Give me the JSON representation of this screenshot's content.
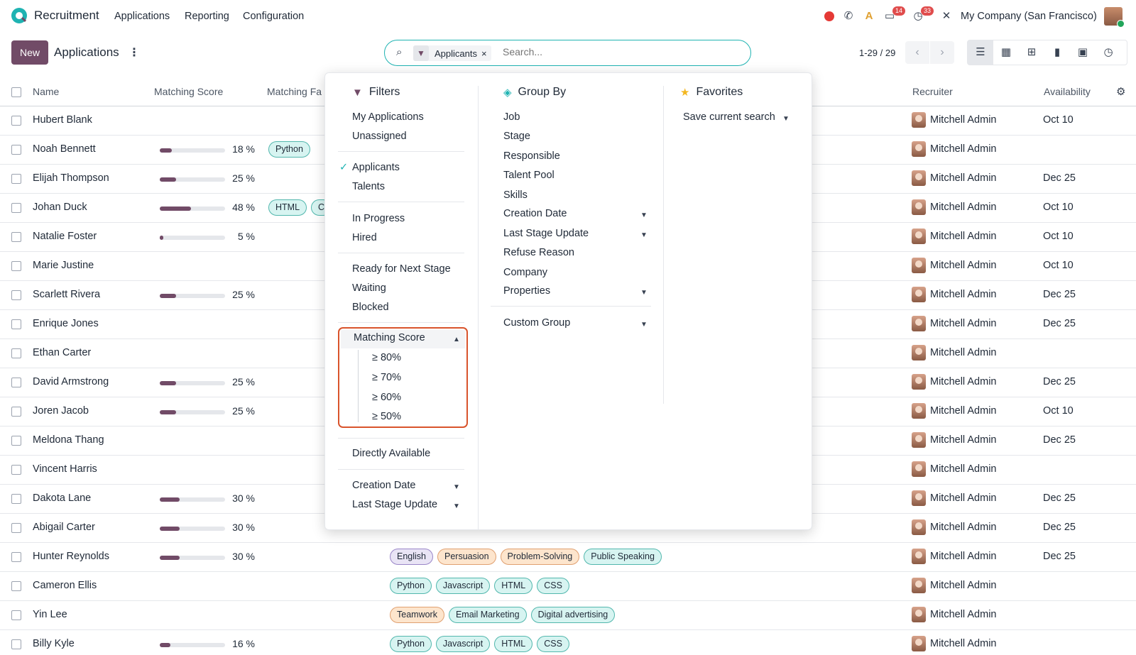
{
  "navbar": {
    "app_title": "Recruitment",
    "menu": [
      "Applications",
      "Reporting",
      "Configuration"
    ],
    "badges": {
      "messages": "14",
      "activities": "33"
    },
    "company": "My Company (San Francisco)"
  },
  "control": {
    "new_label": "New",
    "title": "Applications",
    "kebab": "⋮",
    "facet_label": "Applicants",
    "facet_remove": "×",
    "search_placeholder": "Search...",
    "pager": "1-29 / 29"
  },
  "columns": {
    "name": "Name",
    "matching_score": "Matching Score",
    "matching_factors": "Matching Fa",
    "recruiter": "Recruiter",
    "availability": "Availability"
  },
  "rows": [
    {
      "name": "Hubert Blank",
      "score": null,
      "score_label": "",
      "tags": [],
      "recruiter": "Mitchell Admin",
      "availability": "Oct 10"
    },
    {
      "name": "Noah Bennett",
      "score": 18,
      "score_label": "18 %",
      "tags": [
        {
          "label": "Python",
          "color": "teal"
        }
      ],
      "recruiter": "Mitchell Admin",
      "availability": ""
    },
    {
      "name": "Elijah Thompson",
      "score": 25,
      "score_label": "25 %",
      "tags": [],
      "recruiter": "Mitchell Admin",
      "availability": "Dec 25"
    },
    {
      "name": "Johan Duck",
      "score": 48,
      "score_label": "48 %",
      "tags": [
        {
          "label": "HTML",
          "color": "teal"
        },
        {
          "label": "C",
          "color": "teal"
        }
      ],
      "recruiter": "Mitchell Admin",
      "availability": "Oct 10"
    },
    {
      "name": "Natalie Foster",
      "score": 5,
      "score_label": "5 %",
      "tags": [],
      "recruiter": "Mitchell Admin",
      "availability": "Oct 10"
    },
    {
      "name": "Marie Justine",
      "score": null,
      "score_label": "",
      "tags": [],
      "recruiter": "Mitchell Admin",
      "availability": "Oct 10"
    },
    {
      "name": "Scarlett Rivera",
      "score": 25,
      "score_label": "25 %",
      "tags": [],
      "recruiter": "Mitchell Admin",
      "availability": "Dec 25"
    },
    {
      "name": "Enrique Jones",
      "score": null,
      "score_label": "",
      "tags": [],
      "recruiter": "Mitchell Admin",
      "availability": "Dec 25"
    },
    {
      "name": "Ethan Carter",
      "score": null,
      "score_label": "",
      "tags": [],
      "recruiter": "Mitchell Admin",
      "availability": ""
    },
    {
      "name": "David Armstrong",
      "score": 25,
      "score_label": "25 %",
      "tags": [],
      "recruiter": "Mitchell Admin",
      "availability": "Dec 25"
    },
    {
      "name": "Joren Jacob",
      "score": 25,
      "score_label": "25 %",
      "tags": [],
      "recruiter": "Mitchell Admin",
      "availability": "Oct 10"
    },
    {
      "name": "Meldona Thang",
      "score": null,
      "score_label": "",
      "tags": [],
      "recruiter": "Mitchell Admin",
      "availability": "Dec 25"
    },
    {
      "name": "Vincent Harris",
      "score": null,
      "score_label": "",
      "tags": [],
      "recruiter": "Mitchell Admin",
      "availability": ""
    },
    {
      "name": "Dakota Lane",
      "score": 30,
      "score_label": "30 %",
      "tags": [],
      "recruiter": "Mitchell Admin",
      "availability": "Dec 25"
    },
    {
      "name": "Abigail Carter",
      "score": 30,
      "score_label": "30 %",
      "tags": [],
      "recruiter": "Mitchell Admin",
      "availability": "Dec 25"
    },
    {
      "name": "Hunter Reynolds",
      "score": 30,
      "score_label": "30 %",
      "tags": [
        {
          "label": "English",
          "color": "purple"
        },
        {
          "label": "Persuasion",
          "color": "orange"
        },
        {
          "label": "Problem-Solving",
          "color": "orange"
        },
        {
          "label": "Public Speaking",
          "color": "teal"
        }
      ],
      "recruiter": "Mitchell Admin",
      "availability": "Dec 25"
    },
    {
      "name": "Cameron Ellis",
      "score": null,
      "score_label": "",
      "tags": [
        {
          "label": "Python",
          "color": "teal"
        },
        {
          "label": "Javascript",
          "color": "teal"
        },
        {
          "label": "HTML",
          "color": "teal"
        },
        {
          "label": "CSS",
          "color": "teal"
        }
      ],
      "recruiter": "Mitchell Admin",
      "availability": ""
    },
    {
      "name": "Yin Lee",
      "score": null,
      "score_label": "",
      "tags": [
        {
          "label": "Teamwork",
          "color": "orange"
        },
        {
          "label": "Email Marketing",
          "color": "teal"
        },
        {
          "label": "Digital advertising",
          "color": "teal"
        }
      ],
      "recruiter": "Mitchell Admin",
      "availability": ""
    },
    {
      "name": "Billy Kyle",
      "score": 16,
      "score_label": "16 %",
      "tags": [
        {
          "label": "Python",
          "color": "teal"
        },
        {
          "label": "Javascript",
          "color": "teal"
        },
        {
          "label": "HTML",
          "color": "teal"
        },
        {
          "label": "CSS",
          "color": "teal"
        }
      ],
      "recruiter": "Mitchell Admin",
      "availability": ""
    }
  ],
  "dropdown": {
    "filters": {
      "title": "Filters",
      "group1": [
        "My Applications",
        "Unassigned"
      ],
      "group2": [
        {
          "label": "Applicants",
          "checked": true
        },
        {
          "label": "Talents",
          "checked": false
        }
      ],
      "group3": [
        "In Progress",
        "Hired"
      ],
      "group4": [
        "Ready for Next Stage",
        "Waiting",
        "Blocked"
      ],
      "matching_score": {
        "label": "Matching Score",
        "options": [
          "≥ 80%",
          "≥ 70%",
          "≥ 60%",
          "≥ 50%"
        ]
      },
      "directly_available": "Directly Available",
      "date_options": [
        "Creation Date",
        "Last Stage Update"
      ],
      "check_mark": "✓"
    },
    "group_by": {
      "title": "Group By",
      "options": [
        "Job",
        "Stage",
        "Responsible",
        "Talent Pool",
        "Skills",
        "Creation Date",
        "Last Stage Update",
        "Refuse Reason",
        "Company",
        "Properties"
      ],
      "custom_group": "Custom Group"
    },
    "favorites": {
      "title": "Favorites",
      "save_search": "Save current search"
    }
  },
  "colors": {
    "brand": "#714b67",
    "accent": "#1fb3b2",
    "highlight_border": "#d9542c"
  }
}
